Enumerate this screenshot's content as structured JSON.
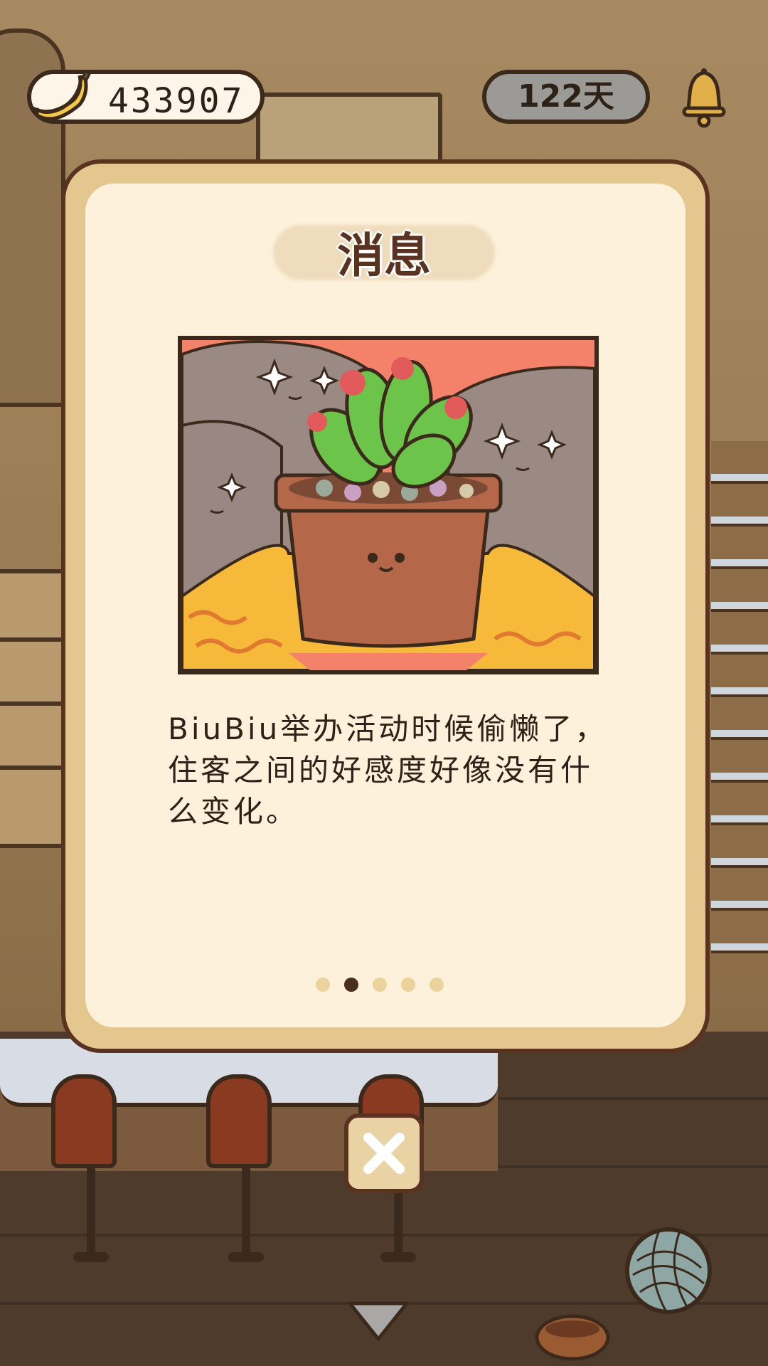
{
  "hud": {
    "currency": {
      "icon": "banana-icon",
      "value": "433907"
    },
    "days": {
      "value": "122天"
    },
    "notification": {
      "icon": "bell-icon"
    }
  },
  "modal": {
    "title": "消息",
    "illustration": "potted-plant-illustration",
    "message": "BiuBiu举办活动时候偷懒了，住客之间的好感度好像没有什么变化。",
    "pager": {
      "total": 5,
      "current_index": 1
    },
    "close": {
      "icon": "close-icon"
    }
  },
  "bottom": {
    "yarn": {
      "icon": "yarn-ball-icon"
    },
    "scroll": {
      "icon": "down-arrow-icon"
    }
  },
  "colors": {
    "modal_border": "#5a3320",
    "modal_frame": "#e4c68f",
    "modal_bg": "#fdf1dc",
    "pager_active": "#4a2e20",
    "pager_inactive": "#ecd29b"
  }
}
